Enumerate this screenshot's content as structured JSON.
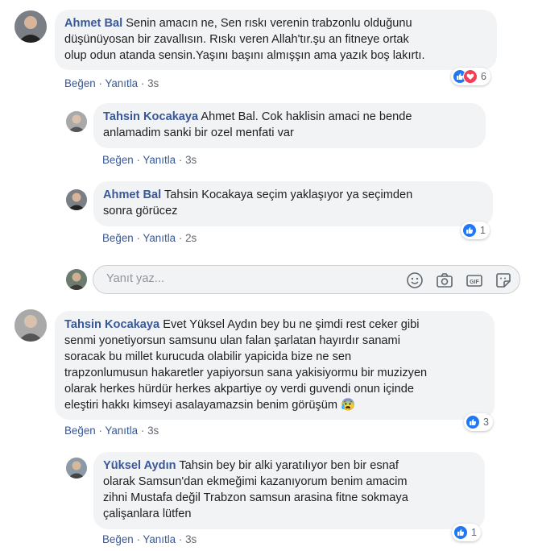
{
  "comments": [
    {
      "author": "Ahmet Bal",
      "text_lines": [
        "Senin amacın ne, Sen rıskı verenin trabzonlu olduğunu",
        "düşünüyosan bir zavallısın. Rıskı veren Allah'tır.şu an fitneye ortak",
        "olup odun atanda sensin.Yaşını başını almışşın ama yazık boş lakırtı."
      ],
      "like_label": "Beğen",
      "reply_label": "Yanıtla",
      "time": "3s",
      "reaction_count": "6"
    },
    {
      "author": "Tahsin Kocakaya",
      "mention": "Ahmet Bal.",
      "text_lines": [
        "Cok haklisin amaci ne bende",
        "anlamadim sanki bir ozel menfati var"
      ],
      "like_label": "Beğen",
      "reply_label": "Yanıtla",
      "time": "3s"
    },
    {
      "author": "Ahmet Bal",
      "mention": "Tahsin Kocakaya",
      "text_lines": [
        "seçim yaklaşıyor ya seçimden",
        "sonra görücez"
      ],
      "like_label": "Beğen",
      "reply_label": "Yanıtla",
      "time": "2s",
      "reaction_count": "1"
    },
    {
      "author": "Tahsin Kocakaya",
      "mention": "Evet Yüksel Aydın",
      "text_lines": [
        "bey bu ne şimdi rest ceker gibi",
        "senmi yonetiyorsun samsunu ulan falan şarlatan hayırdır sanami",
        "soracak bu millet kurucuda olabilir yapicida bize ne sen",
        "trapzonlumusun hakaretler yapiyorsun sana yakisiyormu bir muzizyen",
        "olarak herkes hürdür herkes akpartiye oy verdi guvendi onun içinde",
        "eleştiri hakkı kimseyi asalayamazsin benim görüşüm"
      ],
      "emoji": "😰",
      "like_label": "Beğen",
      "reply_label": "Yanıtla",
      "time": "3s",
      "reaction_count": "3"
    },
    {
      "author": "Yüksel Aydın",
      "text_lines": [
        "Tahsin bey bir alki yaratılıyor ben bir esnaf",
        "olarak Samsun'dan ekmeğimi kazanıyorum benim amacim",
        "zihni Mustafa değil Trabzon samsun arasina fitne sokmaya",
        "çalişanlara lütfen"
      ],
      "like_label": "Beğen",
      "reply_label": "Yanıtla",
      "time": "3s",
      "reaction_count": "1"
    }
  ],
  "reply_box": {
    "placeholder": "Yanıt yaz..."
  },
  "colors": {
    "link": "#385898",
    "bubble": "#f2f3f5",
    "like": "#2078f4",
    "love": "#f33e58"
  },
  "icons": [
    "smile-icon",
    "camera-icon",
    "gif-icon",
    "sticker-icon"
  ]
}
